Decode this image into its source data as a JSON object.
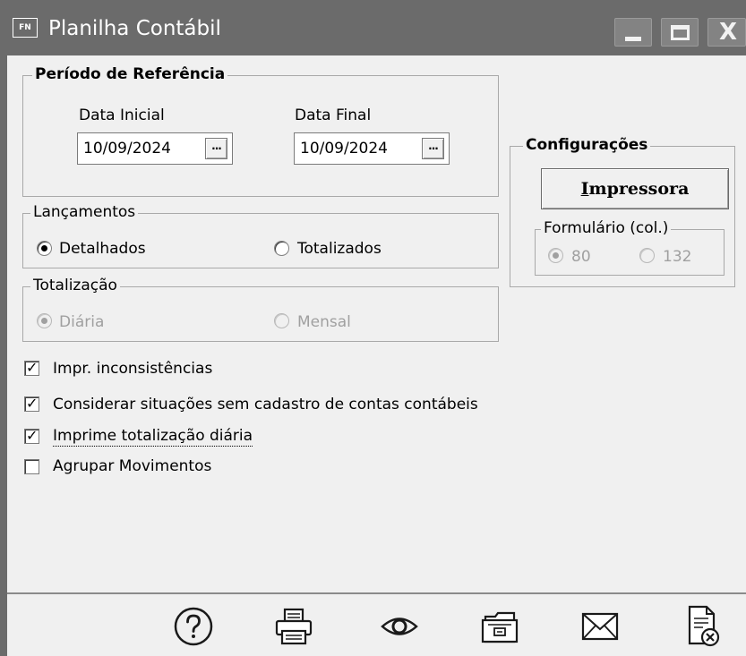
{
  "window": {
    "title": "Planilha Contábil",
    "app_icon_text": "FN",
    "minimize_glyph": "_",
    "maximize_glyph": "□",
    "close_glyph": "X"
  },
  "periodo": {
    "legend": "Período de Referência",
    "data_inicial_label": "Data Inicial",
    "data_inicial_value": "10/09/2024",
    "data_final_label": "Data Final",
    "data_final_value": "10/09/2024",
    "picker_label": "..."
  },
  "lancamentos": {
    "legend": "Lançamentos",
    "options": [
      "Detalhados",
      "Totalizados"
    ],
    "selected": "Detalhados"
  },
  "totalizacao": {
    "legend": "Totalização",
    "options": [
      "Diária",
      "Mensal"
    ],
    "selected": "Diária",
    "enabled": false
  },
  "configuracoes": {
    "legend": "Configurações",
    "printer_button": "Impressora",
    "printer_button_underlined_char": "I",
    "printer_button_rest": "mpressora",
    "formulario": {
      "legend": "Formulário (col.)",
      "options": [
        "80",
        "132"
      ],
      "selected": "80",
      "enabled": false
    }
  },
  "checkboxes": [
    {
      "label": "Impr. inconsistências",
      "checked": true
    },
    {
      "label": "Considerar situações sem cadastro de contas contábeis",
      "checked": true
    },
    {
      "label": "Imprime totalização diária",
      "checked": true
    },
    {
      "label": "Agrupar Movimentos",
      "checked": false
    }
  ],
  "check_glyph": "✓",
  "toolbar": {
    "icons": [
      "help-icon",
      "printer-icon",
      "preview-icon",
      "archive-icon",
      "email-icon",
      "close-document-icon"
    ]
  },
  "colors": {
    "titlebar": "#6b6b6b",
    "window_bg": "#f0f0f0",
    "disabled_text": "#a0a0a0"
  }
}
